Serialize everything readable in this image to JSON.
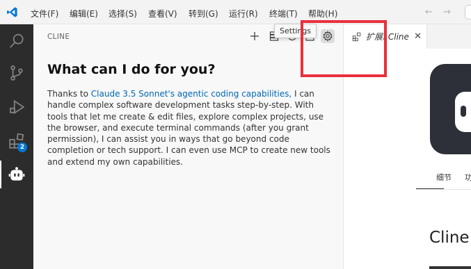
{
  "menubar": {
    "items": [
      "文件(F)",
      "编辑(E)",
      "选择(S)",
      "查看(V)",
      "转到(G)",
      "运行(R)",
      "终端(T)",
      "帮助(H)"
    ],
    "back_icon": "arrow-left-icon",
    "forward_icon": "arrow-right-icon"
  },
  "activitybar": {
    "items": [
      {
        "name": "explorer-search",
        "icon": "search-icon"
      },
      {
        "name": "source-control",
        "icon": "source-control-icon"
      },
      {
        "name": "run-debug",
        "icon": "run-debug-icon"
      },
      {
        "name": "extensions",
        "icon": "extensions-icon",
        "badge": "2"
      },
      {
        "name": "cline",
        "icon": "cline-robot-icon",
        "active": true
      }
    ]
  },
  "sidebar": {
    "title": "CLINE",
    "actions": [
      "plus-icon",
      "server-icon",
      "history-icon",
      "popout-icon",
      "gear-icon"
    ],
    "tooltip": "Settings",
    "heading": "What can I do for you?",
    "text_before_link": "Thanks to ",
    "link_text": "Claude 3.5 Sonnet's agentic coding capabilities,",
    "text_after_link": " I can handle complex software development tasks step-by-step. With tools that let me create & edit files, explore complex projects, use the browser, and execute terminal commands (after you grant permission), I can assist you in ways that go beyond code completion or tech support. I can even use MCP to create new tools and extend my own capabilities."
  },
  "editor": {
    "tab_label": "扩展: Cline",
    "close_icon": "close-icon",
    "ext_tabs": [
      "细节",
      "功"
    ],
    "ext_name": "Cline"
  },
  "colors": {
    "accent": "#0078d4",
    "link": "#0067b8",
    "highlight": "#e8303d",
    "activitybar": "#2c2c2c"
  }
}
